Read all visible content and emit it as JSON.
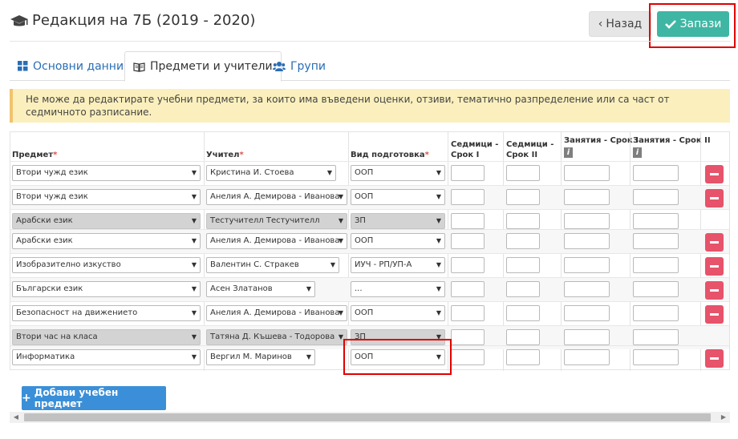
{
  "header": {
    "title": "Редакция на 7Б (2019 - 2020)",
    "back_label": "Назад",
    "save_label": "Запази",
    "icons": {
      "title": "graduation-cap-icon",
      "back": "chevron-left-icon",
      "save": "check-icon"
    }
  },
  "tabs": [
    {
      "label": "Основни данни",
      "icon": "grid-icon",
      "active": false
    },
    {
      "label": "Предмети и учители",
      "icon": "book-icon",
      "active": true
    },
    {
      "label": "Групи",
      "icon": "users-icon",
      "active": false
    }
  ],
  "alert": {
    "text": "Не може да редактирате учебни предмети, за които има въведени оценки, отзиви, тематично разпределение или са част от седмичното разписание."
  },
  "table": {
    "headers": {
      "subject": "Предмет",
      "teacher": "Учител",
      "prep": "Вид подготовка",
      "required_mark": "*",
      "weeks1_a": "Седмици -",
      "weeks1_b": "Срок I",
      "weeks2_a": "Седмици -",
      "weeks2_b": "Срок II",
      "classes1": "Занятия - Срок I",
      "classes2": "Занятия - Срок II",
      "info_icon": "i"
    },
    "rows": [
      {
        "subject": "Втори чужд език",
        "teacher": "Кристина И. Стоева",
        "prep": "ООП",
        "disabled": false,
        "deletable": true
      },
      {
        "subject": "Втори чужд език",
        "teacher": "Анелия А. Демирова - Иванова",
        "prep": "ООП",
        "disabled": false,
        "deletable": true
      },
      {
        "subject": "Арабски език",
        "teacher": "Тестучителл Тестучителл",
        "prep": "ЗП",
        "disabled": true,
        "deletable": false
      },
      {
        "subject": "Арабски език",
        "teacher": "Анелия А. Демирова - Иванова",
        "prep": "ООП",
        "disabled": false,
        "deletable": true
      },
      {
        "subject": "Изобразително изкуство",
        "teacher": "Валентин С. Стракев",
        "prep": "ИУЧ - РП/УП-А",
        "disabled": false,
        "deletable": true
      },
      {
        "subject": "Български език",
        "teacher": "Асен Златанов",
        "prep": "...",
        "disabled": false,
        "deletable": true
      },
      {
        "subject": "Безопасност на движението",
        "teacher": "Анелия А. Демирова - Иванова",
        "prep": "ООП",
        "disabled": false,
        "deletable": true
      },
      {
        "subject": "Втори час на класа",
        "teacher": "Татяна Д. Къшева - Тодорова",
        "prep": "ЗП",
        "disabled": true,
        "deletable": false
      },
      {
        "subject": "Информатика",
        "teacher": "Вергил М. Маринов",
        "prep": "ООП",
        "disabled": false,
        "deletable": true
      }
    ]
  },
  "add_button": {
    "label": "Добави учебен предмет",
    "icon": "plus-icon"
  },
  "colors": {
    "save": "#3fb6a3",
    "delete": "#e6536a",
    "add": "#3a8fd8",
    "alert_bg": "#fbf0bd",
    "highlight": "#e00000"
  }
}
